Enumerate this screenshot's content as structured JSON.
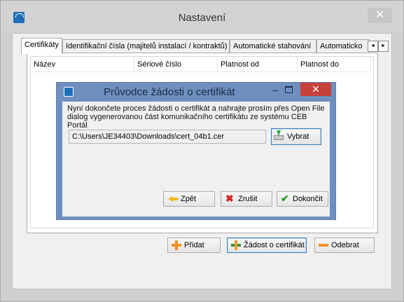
{
  "window": {
    "title": "Nastavení",
    "close_glyph": "✕"
  },
  "tabs": [
    {
      "label": "Certifikáty",
      "active": true
    },
    {
      "label": "Identifikační čísla (majitelů instalací / kontraktů)",
      "active": false
    },
    {
      "label": "Automatické stahování",
      "active": false
    },
    {
      "label": "Automaticko",
      "active": false
    }
  ],
  "tab_scroll": {
    "left": "◄",
    "right": "►"
  },
  "certificates_list": {
    "columns": [
      "Název",
      "Sériové číslo",
      "Platnost od",
      "Platnost do"
    ],
    "rows": []
  },
  "actions": {
    "add_label": "Přidat",
    "request_label": "Žádost o certifikát",
    "remove_label": "Odebrat"
  },
  "dialog": {
    "title": "Průvodce žádosti o certifikát",
    "minimize_glyph": "–",
    "close_glyph": "✕",
    "message": "Nyní dokončete proces žádosti o certifikát a nahrajte prosím přes Open File dialog vygenerovanou část komunikačního certifikátu ze systému CEB Portál",
    "file_path": "C:\\Users\\JE34403\\Downloads\\cert_04b1.cer",
    "browse_label": "Vybrat",
    "back_label": "Zpět",
    "cancel_label": "Zrušit",
    "finish_label": "Dokončit"
  },
  "icons": {
    "app": "ceb-app-icon",
    "add": "plus-icon",
    "request": "certificate-request-icon",
    "remove": "minus-icon",
    "browse": "download-icon",
    "back": "arrow-left-icon",
    "cancel": "x-icon",
    "finish": "checkmark-icon"
  },
  "colors": {
    "dialog_frame": "#6f8fbf",
    "dialog_close": "#c7413b",
    "accent_orange": "#f5912b"
  }
}
